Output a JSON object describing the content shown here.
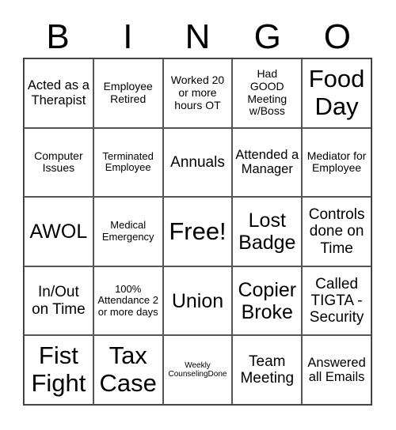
{
  "header": {
    "letters": [
      "B",
      "I",
      "N",
      "G",
      "O"
    ]
  },
  "cells": [
    [
      "Acted as a Therapist",
      "Employee Retired",
      "Worked 20 or more hours OT",
      "Had GOOD Meeting w/Boss",
      "Food Day"
    ],
    [
      "Computer Issues",
      "Terminated Employee",
      "Annuals",
      "Attended a Manager",
      "Mediator for Employee"
    ],
    [
      "AWOL",
      "Medical Emergency",
      "Free!",
      "Lost Badge",
      "Controls done on Time"
    ],
    [
      "In/Out on Time",
      "100% Attendance 2 or more days",
      "Union",
      "Copier Broke",
      "Called TIGTA - Security"
    ],
    [
      "Fist Fight",
      "Tax Case",
      "Weekly CounselingDone",
      "Team Meeting",
      "Answered all Emails"
    ]
  ]
}
